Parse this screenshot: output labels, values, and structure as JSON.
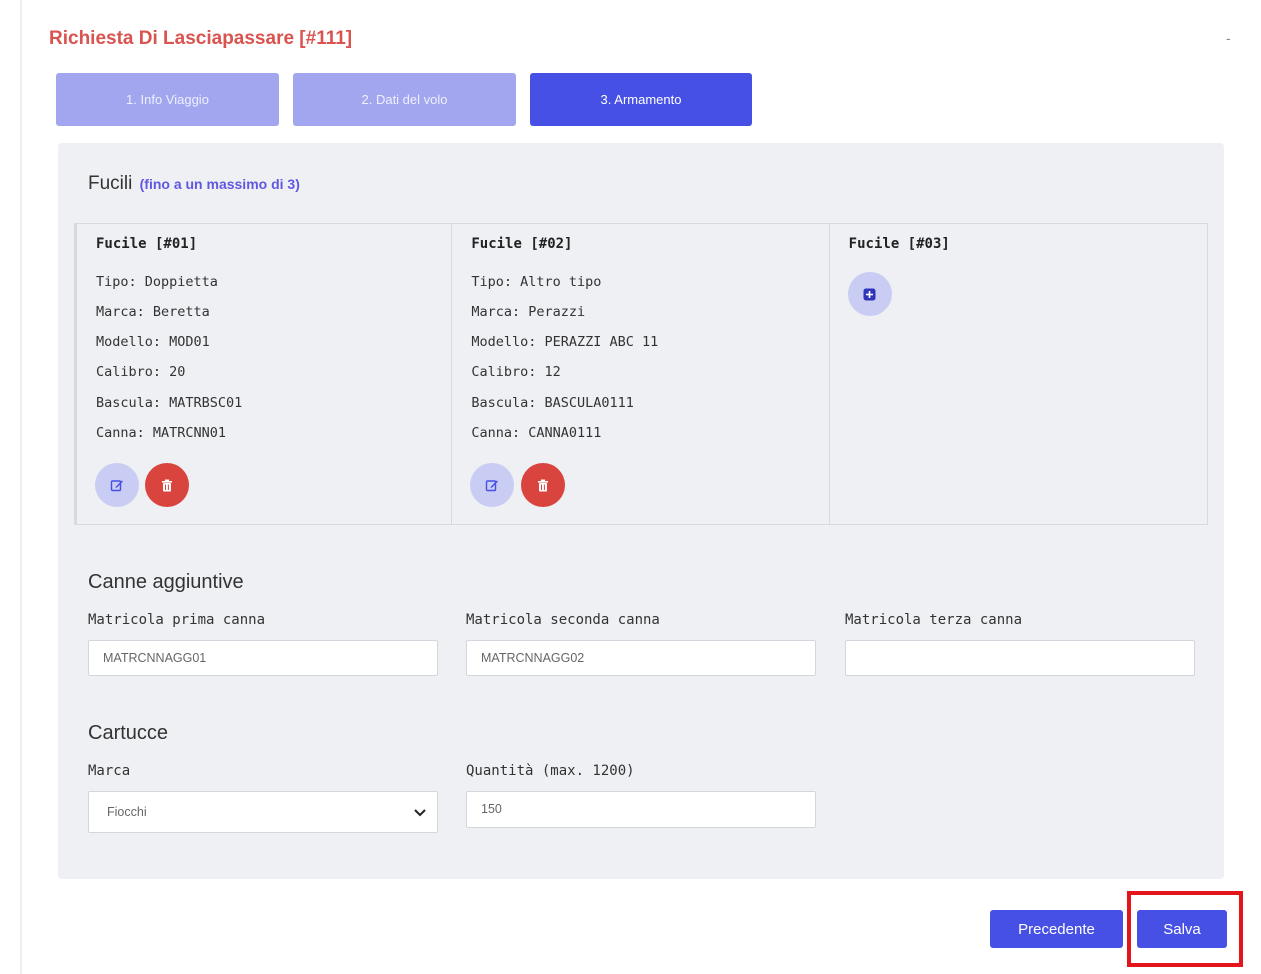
{
  "header": {
    "title": "Richiesta Di Lasciapassare [#111]",
    "collapse_symbol": "-"
  },
  "tabs": [
    {
      "label": "1. Info Viaggio",
      "state": "completed"
    },
    {
      "label": "2. Dati del volo",
      "state": "completed"
    },
    {
      "label": "3. Armamento",
      "state": "active"
    }
  ],
  "fucili": {
    "title": "Fucili",
    "note": "(fino a un massimo di 3)",
    "items": [
      {
        "heading": "Fucile [#01]",
        "tipo": "Tipo: Doppietta",
        "marca": "Marca: Beretta",
        "modello": "Modello: MOD01",
        "calibro": "Calibro: 20",
        "bascula": "Bascula: MATRBSC01",
        "canna": "Canna: MATRCNN01"
      },
      {
        "heading": "Fucile [#02]",
        "tipo": "Tipo: Altro tipo",
        "marca": "Marca: Perazzi",
        "modello": "Modello: PERAZZI ABC 11",
        "calibro": "Calibro: 12",
        "bascula": "Bascula: BASCULA0111",
        "canna": "Canna: CANNA0111"
      },
      {
        "heading": "Fucile [#03]"
      }
    ],
    "icons": {
      "edit": "edit-icon",
      "delete": "trash-icon",
      "add": "plus-square-icon"
    }
  },
  "canne": {
    "title": "Canne aggiuntive",
    "fields": [
      {
        "label": "Matricola prima canna",
        "value": "MATRCNNAGG01"
      },
      {
        "label": "Matricola seconda canna",
        "value": "MATRCNNAGG02"
      },
      {
        "label": "Matricola terza canna",
        "value": ""
      }
    ]
  },
  "cartucce": {
    "title": "Cartucce",
    "marca_label": "Marca",
    "marca_value": "Fiocchi",
    "quantita_label": "Quantità (max. 1200)",
    "quantita_value": "150"
  },
  "actions": {
    "prev_label": "Precedente",
    "save_label": "Salva"
  },
  "colors": {
    "title": "#d9534f",
    "primary": "#4650e4",
    "tab_inactive": "#a1a6ee",
    "danger": "#d9443f",
    "highlight": "#e3151a"
  }
}
